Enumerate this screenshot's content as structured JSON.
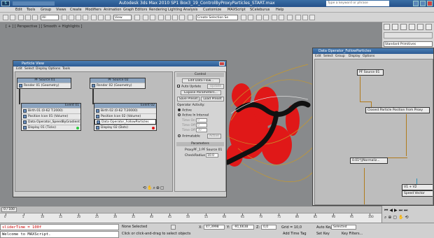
{
  "app": {
    "title": "Autodesk 3ds Max 2010 SP1    Box3_19_ControlByProxyParticles_START.max",
    "search_placeholder": "Type a keyword or phrase"
  },
  "menu": [
    "Edit",
    "Tools",
    "Group",
    "Views",
    "Create",
    "Modifiers",
    "Animation",
    "Graph Editors",
    "Rendering",
    "Lighting Analysis",
    "Customize",
    "MAXScript",
    "SCeleburus",
    "Help"
  ],
  "toolbar": {
    "filter": "All",
    "view": "View",
    "selection_set": "Create Selection Se"
  },
  "viewport": {
    "label": "[ + ] [ Perspective ] [ Smooth + Highlights ]"
  },
  "command_panel": {
    "dropdown": "Standard Primitives"
  },
  "particle_view": {
    "title": "Particle View",
    "menu": [
      "Edit",
      "Select",
      "Display",
      "Options",
      "Tools"
    ],
    "nodes": {
      "source1": {
        "title": "PF Source 01",
        "row": "Render 01 (Geometry)"
      },
      "source2": {
        "title": "PF Source 02",
        "row": "Render 02 (Geometry)"
      },
      "event1": {
        "title": "Event 01",
        "rows": [
          "Birth 01 (0-62 T:2000)",
          "Position Icon 01 (Volume)",
          "Data Operator_SpeedByGradient",
          "Display 01 (Ticks)"
        ]
      },
      "event2": {
        "title": "Event 02",
        "rows": [
          "Birth 02 (0-62 T:20000)",
          "Position Icon 02 (Volume)",
          "Data Operator_FollowParticles",
          "Display 02 (Dots)"
        ]
      }
    },
    "panel": {
      "control_header": "Control",
      "edit_data_flow": "Edit Data Flow...",
      "auto_update": "Auto Update",
      "update": "Update",
      "expose_params": "Expose Parameters...",
      "save_preset": "Save Preset",
      "load_preset": "Load Preset",
      "operator_activity": "Operator Activity:",
      "active": "Active",
      "active_in_interval": "Active In Interval",
      "time_on": "Time On",
      "time_on_val": "0",
      "time_off": "Time Off",
      "time_off_val": "0",
      "time_offset": "Time Off",
      "time_offset_val": "30",
      "animatable": "Animatable",
      "active_btn": "Active",
      "params_header": "Parameters",
      "proxypf_label": "ProxyPF_1",
      "proxypf_val": "PF Source 01",
      "checkradius_label": "CheckRadius",
      "checkradius_val": "10.0"
    }
  },
  "data_operator": {
    "title": "Data Operator_FollowParticles",
    "menu": [
      "Edit",
      "Select",
      "Group",
      "Display",
      "Options"
    ],
    "nodes": {
      "pf_source": "PF Source 01",
      "closest": "Closest Particle Position from Proxy",
      "normalize": "0.01*||Normaliz...",
      "sum": "V1 + V2",
      "speed": "Speed Vector"
    }
  },
  "timeline": {
    "slider": "0 / 100",
    "ticks": [
      "0",
      "5",
      "10",
      "15",
      "20",
      "25",
      "30",
      "35",
      "40",
      "45",
      "50",
      "55",
      "60",
      "65",
      "70",
      "75",
      "80",
      "85",
      "90",
      "95",
      "100"
    ]
  },
  "status": {
    "script_line1": "sliderTime = 100f",
    "script_line2": "Welcome to MAXScript.",
    "selection": "None Selected",
    "prompt": "Click or click-and-drag to select objects",
    "x_label": "X:",
    "x_val": "47,3998",
    "y_label": "Y:",
    "y_val": "-91,6638",
    "z_label": "Z:",
    "z_val": "0,0",
    "grid": "Grid = 10,0",
    "add_time_tag": "Add Time Tag",
    "auto_key": "Auto Key",
    "auto_key_val": "Selected",
    "set_key": "Set Key",
    "key_filters": "Key Filters..."
  }
}
